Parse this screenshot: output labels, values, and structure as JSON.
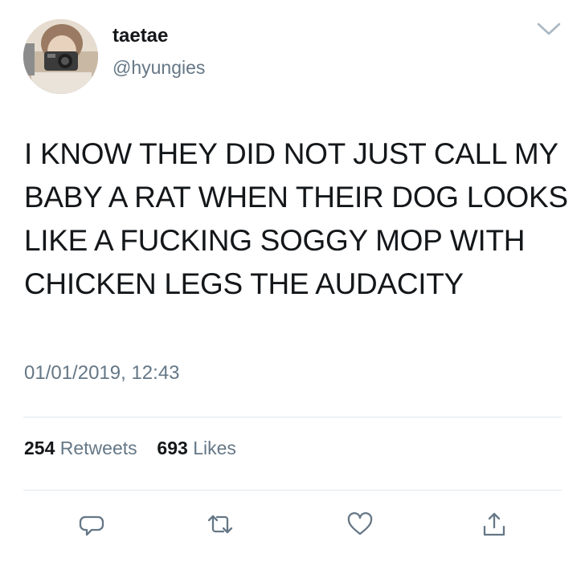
{
  "user": {
    "display_name": "taetae",
    "handle": "@hyungies",
    "avatar_icon": "profile-photo"
  },
  "tweet": {
    "text": "I KNOW THEY DID NOT JUST CALL MY BABY A RAT WHEN THEIR DOG LOOKS LIKE A FUCKING SOGGY MOP WITH CHICKEN LEGS THE AUDACITY",
    "timestamp": "01/01/2019, 12:43"
  },
  "stats": {
    "retweets_count": "254",
    "retweets_label": "Retweets",
    "likes_count": "693",
    "likes_label": "Likes"
  },
  "actions": [
    {
      "name": "reply",
      "icon": "reply-icon"
    },
    {
      "name": "retweet",
      "icon": "retweet-icon"
    },
    {
      "name": "like",
      "icon": "heart-icon"
    },
    {
      "name": "share",
      "icon": "share-icon"
    }
  ],
  "colors": {
    "text": "#14171a",
    "secondary": "#657786",
    "divider": "#e1e8ed",
    "icon": "#657786"
  }
}
